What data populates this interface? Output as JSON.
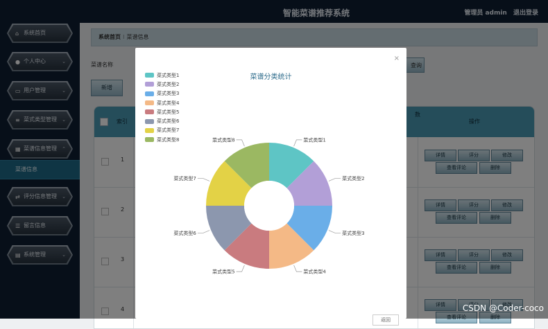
{
  "header": {
    "title": "智能菜谱推荐系统",
    "user_label": "管理员 admin",
    "logout": "退出登录"
  },
  "sidebar": {
    "items": [
      {
        "label": "系统首页",
        "icon": "home-icon",
        "has_arrow": false
      },
      {
        "label": "个人中心",
        "icon": "user-icon",
        "has_arrow": true,
        "arrow": "⌄"
      },
      {
        "label": "用户管理",
        "icon": "monitor-icon",
        "has_arrow": true,
        "arrow": "⌄"
      },
      {
        "label": "菜式类型管理",
        "icon": "list-icon",
        "has_arrow": true,
        "arrow": "⌄"
      },
      {
        "label": "菜谱信息管理",
        "icon": "grid-icon",
        "has_arrow": true,
        "arrow": "⌃"
      },
      {
        "label": "评分信息管理",
        "icon": "exchange-icon",
        "has_arrow": true,
        "arrow": "⌄"
      },
      {
        "label": "留言信息",
        "icon": "menu-icon",
        "has_arrow": false
      },
      {
        "label": "系统管理",
        "icon": "chart-icon",
        "has_arrow": true,
        "arrow": "⌄"
      }
    ],
    "sub_item": "菜谱信息"
  },
  "main": {
    "breadcrumb": {
      "home": "系统首页",
      "sep": "⁝",
      "current": "菜谱信息"
    },
    "search_label": "菜谱名称",
    "add_button": "新增",
    "search_edge_text": "查询",
    "table": {
      "idx_header": "索引",
      "partial_header": "数",
      "ops_header": "操作",
      "rows": [
        {
          "index": "1"
        },
        {
          "index": "2"
        },
        {
          "index": "3"
        },
        {
          "index": "4"
        }
      ],
      "op_buttons": {
        "detail": "详情",
        "rate": "评分",
        "edit": "修改",
        "comments": "查看评论",
        "delete": "删除"
      }
    }
  },
  "modal": {
    "close": "×",
    "button_text": "返回"
  },
  "chart_data": {
    "type": "pie",
    "title": "菜谱分类统计",
    "donut": true,
    "legend_position": "top-left",
    "categories": [
      "菜式类型1",
      "菜式类型2",
      "菜式类型3",
      "菜式类型4",
      "菜式类型5",
      "菜式类型6",
      "菜式类型7",
      "菜式类型8"
    ],
    "values": [
      1,
      1,
      1,
      1,
      1,
      1,
      1,
      1
    ],
    "colors": [
      "#5ec5c5",
      "#b29fd7",
      "#6aaee8",
      "#f4b986",
      "#c97b7f",
      "#8c97ae",
      "#e3d246",
      "#9bb862"
    ]
  },
  "watermark": "CSDN @Coder-coco"
}
